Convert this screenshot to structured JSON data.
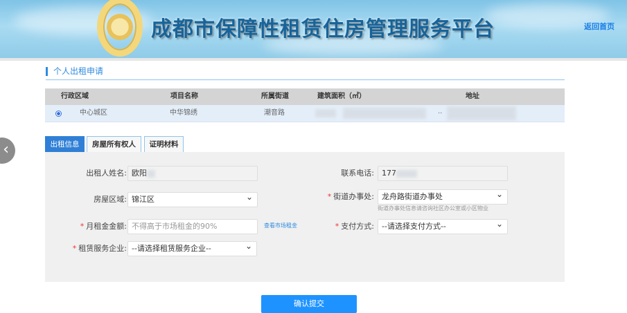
{
  "header": {
    "title": "成都市保障性租赁住房管理服务平台",
    "home_link": "返回首页"
  },
  "section": {
    "title": "个人出租申请"
  },
  "table": {
    "columns": [
      "行政区域",
      "项目名称",
      "所属街道",
      "建筑面积（㎡）",
      "地址"
    ],
    "rows": [
      {
        "selected": true,
        "district": "中心城区",
        "project": "中华锦绣",
        "street": "潮音路",
        "area": "",
        "address": ".."
      }
    ]
  },
  "tabs": [
    {
      "label": "出租信息",
      "active": true
    },
    {
      "label": "房屋所有权人",
      "active": false
    },
    {
      "label": "证明材料",
      "active": false
    }
  ],
  "form": {
    "name_label": "出租人姓名:",
    "name_value": "欧阳",
    "phone_label": "联系电话:",
    "phone_value": "177",
    "region_label": "房屋区域:",
    "region_value": "锦江区",
    "street_office_label": "街道办事处:",
    "street_office_value": "龙舟路街道办事处",
    "street_office_hint": "街道办事处信息请咨询社区办公室或小区物业",
    "rent_label": "月租金金额:",
    "rent_placeholder": "不得高于市场租金的90%",
    "market_rent_link": "查看市场租金",
    "payment_label": "支付方式:",
    "payment_value": "--请选择支付方式--",
    "service_company_label": "租赁服务企业:",
    "service_company_value": "--请选择租赁服务企业--",
    "required_mark": "*"
  },
  "submit_label": "确认提交",
  "nav": {
    "prev_icon": "chevron-left"
  }
}
